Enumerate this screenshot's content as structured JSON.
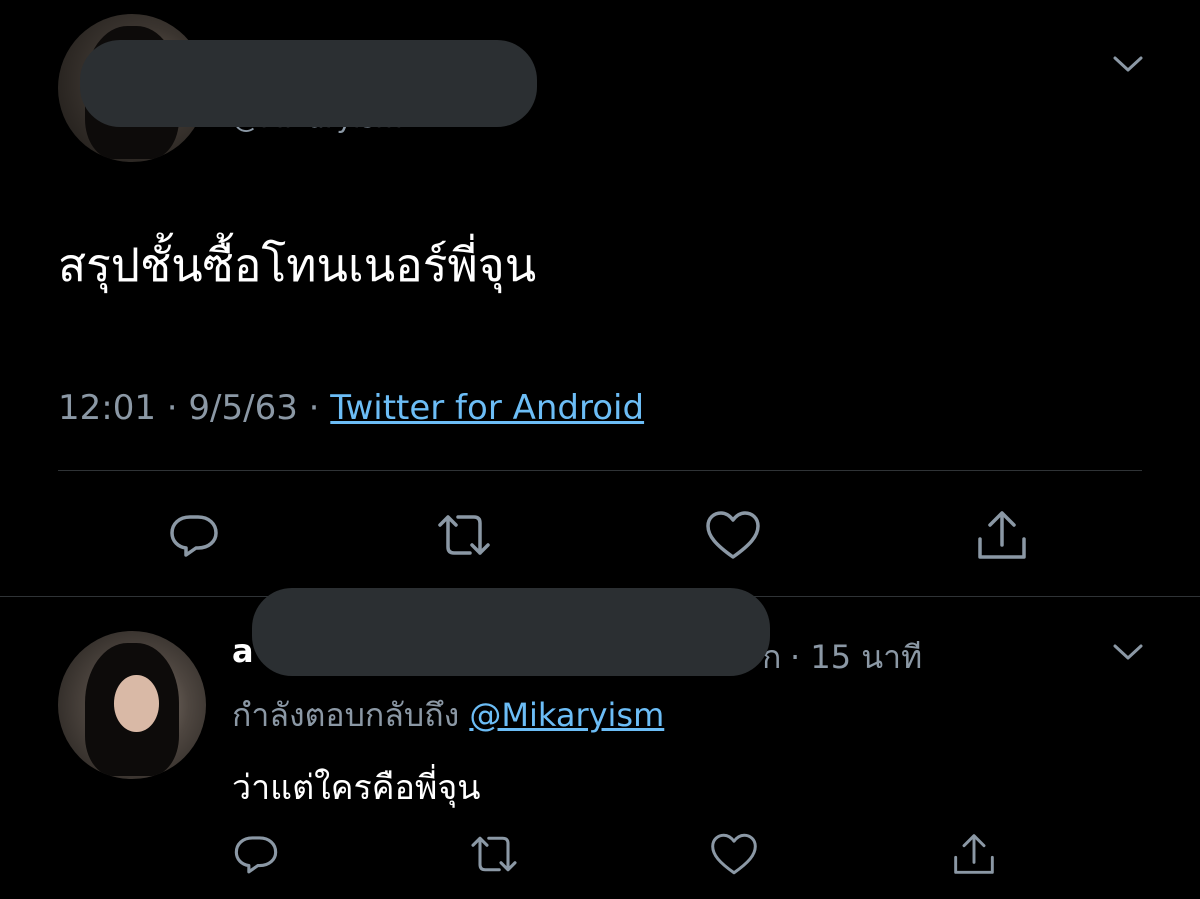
{
  "colors": {
    "background": "#000000",
    "text_primary": "#ffffff",
    "text_secondary": "#8b98a5",
    "link": "#6cbdf6",
    "divider": "#2f3336",
    "redaction": "#2b2f32"
  },
  "main_tweet": {
    "handle_partial": "@Mikaryism",
    "text": "สรุปชั้นซื้อโทนเนอร์พี่จุน",
    "time": "12:01",
    "date": "9/5/63",
    "separator": "·",
    "source": "Twitter for Android",
    "icons": {
      "more": "chevron-down-icon",
      "reply": "reply-icon",
      "retweet": "retweet-icon",
      "like": "heart-icon",
      "share": "share-icon"
    }
  },
  "reply_tweet": {
    "name_initial": "a",
    "name_tail": "ก",
    "time_ago": "· 15 นาที",
    "replying_to_label": "กำลังตอบกลับถึง",
    "replying_to_handle": "@Mikaryism",
    "text": "ว่าแต่ใครคือพี่จุน",
    "icons": {
      "more": "chevron-down-icon",
      "reply": "reply-icon",
      "retweet": "retweet-icon",
      "like": "heart-icon",
      "share": "share-icon"
    }
  }
}
